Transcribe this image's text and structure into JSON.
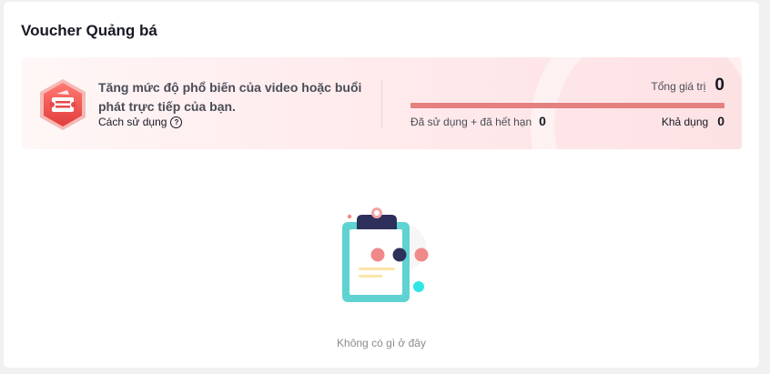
{
  "card": {
    "title": "Voucher Quảng bá"
  },
  "banner": {
    "promo_text": "Tăng mức độ phổ biến của video hoặc buổi phát trực tiếp của bạn.",
    "howto_label": "Cách sử dụng",
    "help_icon": "question-circle-icon",
    "badge_icon": "voucher-ticket-badge-icon",
    "total_label": "Tổng giá trị",
    "total_value": "0",
    "used_label": "Đã sử dụng + đã hết hạn",
    "used_value": "0",
    "available_label": "Khả dụng",
    "available_value": "0",
    "bar_color": "#e58080"
  },
  "empty": {
    "illustration": "empty-clipboard-illustration",
    "message": "Không có gì ở đây"
  },
  "colors": {
    "banner_bg": "#ffeef0",
    "badge": "#e84a4a",
    "accent_teal": "#5fd3d1"
  }
}
